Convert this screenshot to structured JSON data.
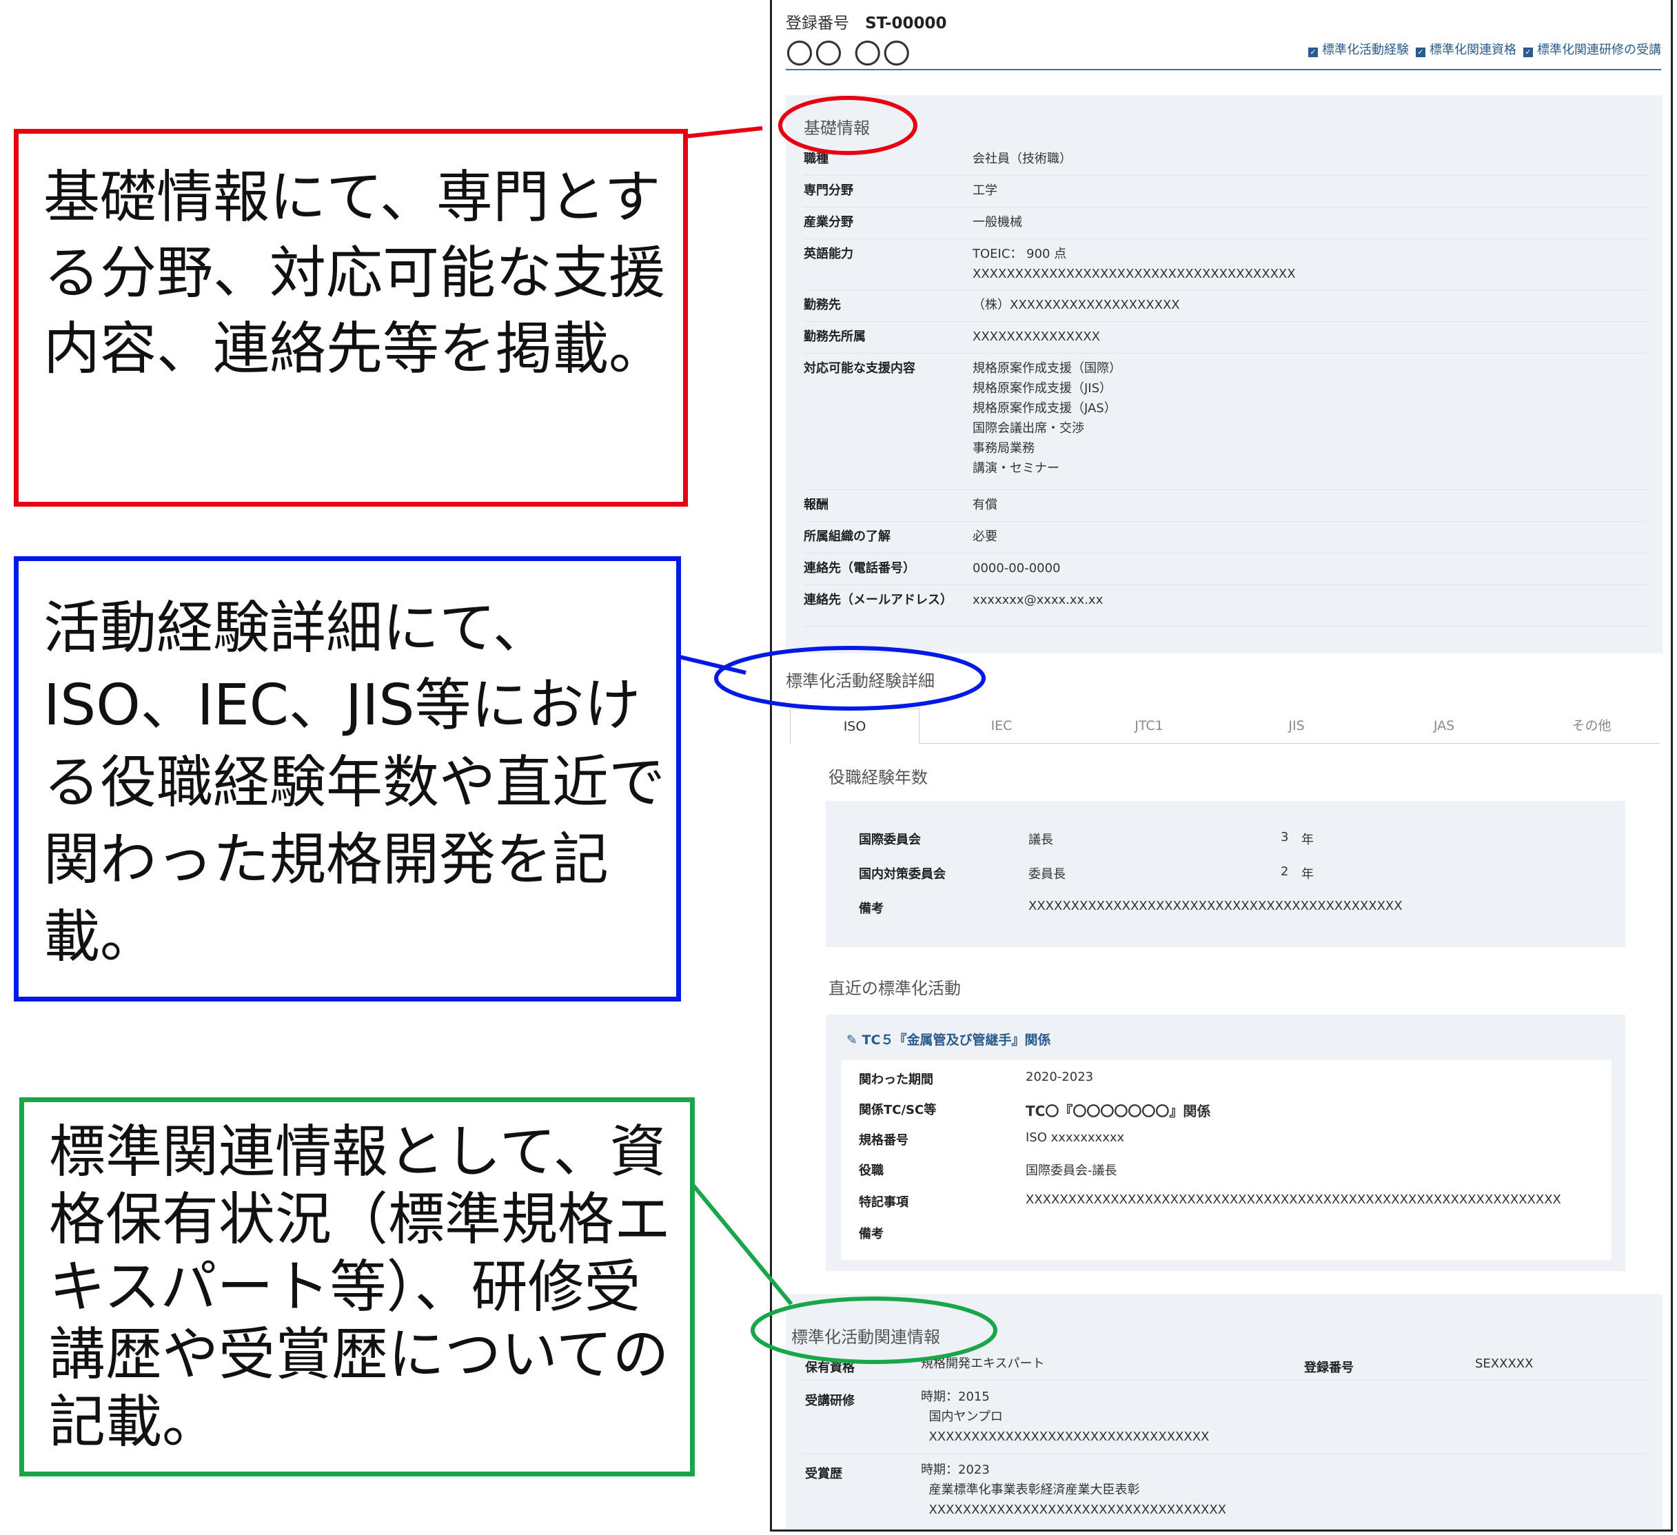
{
  "callouts": {
    "basic": "基礎情報にて、専門とする分野、対応可能な支援内容、連絡先等を掲載。",
    "activity": "活動経験詳細にて、ISO、IEC、JIS等における役職経験年数や直近で関わった規格開発を記載。",
    "related": "標準関連情報として、資格保有状況（標準規格エキスパート等）、研修受講歴や受賞歴についての記載。"
  },
  "header": {
    "reg_label": "登録番号",
    "reg_id": "ST-00000",
    "name": "〇〇 〇〇",
    "checks": [
      "標準化活動経験",
      "標準化関連資格",
      "標準化関連研修の受講"
    ]
  },
  "basic": {
    "title": "基礎情報",
    "rows": [
      {
        "label": "職種",
        "value": "会社員（技術職）"
      },
      {
        "label": "専門分野",
        "value": "工学"
      },
      {
        "label": "産業分野",
        "value": "一般機械"
      },
      {
        "label": "英語能力",
        "value": "TOEIC： 900 点\nXXXXXXXXXXXXXXXXXXXXXXXXXXXXXXXXXXXXXX"
      },
      {
        "label": "勤務先",
        "value": "（株）XXXXXXXXXXXXXXXXXXXX"
      },
      {
        "label": "勤務先所属",
        "value": "XXXXXXXXXXXXXXX"
      },
      {
        "label": "対応可能な支援内容",
        "value": "規格原案作成支援（国際）\n規格原案作成支援（JIS）\n規格原案作成支援（JAS）\n国際会議出席・交渉\n事務局業務\n講演・セミナー"
      },
      {
        "label": "報酬",
        "value": "有償"
      },
      {
        "label": "所属組織の了解",
        "value": "必要"
      },
      {
        "label": "連絡先（電話番号）",
        "value": "0000-00-0000"
      },
      {
        "label": "連絡先（メールアドレス）",
        "value": "xxxxxxx@xxxx.xx.xx"
      }
    ]
  },
  "activity": {
    "title": "標準化活動経験詳細",
    "tabs": [
      "ISO",
      "IEC",
      "JTC1",
      "JIS",
      "JAS",
      "その他"
    ],
    "years_title": "役職経験年数",
    "years": [
      {
        "label": "国際委員会",
        "role": "議長",
        "years": "3",
        "unit": "年"
      },
      {
        "label": "国内対策委員会",
        "role": "委員長",
        "years": "2",
        "unit": "年"
      }
    ],
    "years_note_label": "備考",
    "years_note": "XXXXXXXXXXXXXXXXXXXXXXXXXXXXXXXXXXXXXXXXXXXX",
    "recent_title": "直近の標準化活動",
    "recent_heading": "TC５『金属管及び管継手』関係",
    "recent": [
      {
        "label": "関わった期間",
        "value": "2020-2023"
      },
      {
        "label": "関係TC/SC等",
        "value": "TC〇『〇〇〇〇〇〇〇』関係"
      },
      {
        "label": "規格番号",
        "value": "ISO xxxxxxxxxx"
      },
      {
        "label": "役職",
        "value": "国際委員会-議長"
      },
      {
        "label": "特記事項",
        "value": "XXXXXXXXXXXXXXXXXXXXXXXXXXXXXXXXXXXXXXXXXXXXXXXXXXXXXXXXXXXXXXX"
      },
      {
        "label": "備考",
        "value": ""
      }
    ]
  },
  "related": {
    "title": "標準化活動関連情報",
    "qual_label": "保有資格",
    "qual_value": "規格開発エキスパート",
    "qual_no_label": "登録番号",
    "qual_no": "SEXXXXX",
    "training_label": "受講研修",
    "training_value": "時期：2015\n  国内ヤンプロ\n  XXXXXXXXXXXXXXXXXXXXXXXXXXXXXXXXX",
    "award_label": "受賞歴",
    "award_value": "時期：2023\n  産業標準化事業表彰経済産業大臣表彰\n  XXXXXXXXXXXXXXXXXXXXXXXXXXXXXXXXXXX"
  },
  "colors": {
    "red": "#e60012",
    "blue": "#0019e6",
    "green": "#19a64a",
    "accent": "#2a5b8f"
  }
}
